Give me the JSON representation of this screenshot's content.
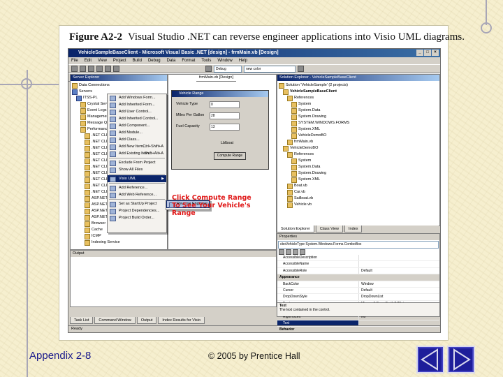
{
  "slide": {
    "figure_label": "Figure A2-2",
    "figure_caption": "Visual Studio .NET can reverse engineer applications into Visio UML diagrams.",
    "footer_left": "Appendix 2-8",
    "footer_center": "© 2005 by Prentice Hall"
  },
  "vs": {
    "title": "VehicleSampleBaseClient - Microsoft Visual Basic .NET [design] - frmMain.vb [Design]",
    "menu": [
      "File",
      "Edit",
      "View",
      "Project",
      "Build",
      "Debug",
      "Data",
      "Format",
      "Tools",
      "Window",
      "Help"
    ],
    "config_combo": "Debug",
    "find_combo": "new color",
    "server_explorer": {
      "title": "Server Explorer",
      "items": [
        "Data Connections",
        "Servers",
        "ITSS-PL",
        "Crystal Services",
        "Event Logs",
        "Management Data",
        "Message Queues",
        "Performance Counters",
        ".NET CLR Data",
        ".NET CLR Exceptions",
        ".NET CLR Interop",
        ".NET CLR Jit",
        ".NET CLR Loading",
        ".NET CLR LocksAndThreads",
        ".NET CLR Memory",
        ".NET CLR Networking",
        ".NET CLR Remoting",
        ".NET CLR Security",
        "ASP.NET",
        "ASP.NET Applications",
        "ASP.NET Apps v1.1.4322",
        "ASP.NET v1.1.4322",
        "Browser",
        "Cache",
        "ICMP",
        "Indexing Service"
      ]
    },
    "project_menu": {
      "items": [
        {
          "label": "Add Windows Form...",
          "key": ""
        },
        {
          "label": "Add Inherited Form...",
          "key": ""
        },
        {
          "label": "Add User Control...",
          "key": ""
        },
        {
          "label": "Add Inherited Control...",
          "key": ""
        },
        {
          "label": "Add Component...",
          "key": ""
        },
        {
          "label": "Add Module...",
          "key": ""
        },
        {
          "label": "Add Class...",
          "key": ""
        },
        {
          "label": "Add New Item...",
          "key": "Ctrl+Shift+A"
        },
        {
          "label": "Add Existing Item...",
          "key": "Shift+Alt+A"
        },
        {
          "label": "Exclude From Project",
          "key": ""
        },
        {
          "label": "Show All Files",
          "key": ""
        },
        {
          "label": "Visio UML",
          "key": ""
        },
        {
          "label": "Add Reference...",
          "key": ""
        },
        {
          "label": "Add Web Reference...",
          "key": ""
        },
        {
          "label": "Set as StartUp Project",
          "key": ""
        },
        {
          "label": "Project Dependencies...",
          "key": ""
        },
        {
          "label": "Project Build Order...",
          "key": ""
        }
      ],
      "submenu_item": "Reverse Engineer"
    },
    "editor": {
      "tab_label": "frmMain.vb [Design]",
      "form_title": "Vehicle Range",
      "fields": [
        {
          "label": "Vehicle Type",
          "value": "0"
        },
        {
          "label": "Miles Per Gallon",
          "value": "28"
        },
        {
          "label": "Fuel Capacity",
          "value": "13"
        }
      ],
      "checkbox_label": "Lblboat",
      "compute_button": "Compute Range",
      "annotation": "Click Compute Range To See Your Vehicle's Range"
    },
    "output_title": "Output",
    "solution_explorer": {
      "title": "Solution Explorer - VehicleSampleBaseClient",
      "items": [
        "Solution 'VehicleSample' (2 projects)",
        "VehicleSampleBaseClient",
        "References",
        "System",
        "System.Data",
        "System.Drawing",
        "SYSTEM.WINDOWS.FORMS",
        "System.XML",
        "VehicleDemoBO",
        "frmMain.vb",
        "VehicleDemoBO",
        "References",
        "System",
        "System.Data",
        "System.Drawing",
        "System.XML",
        "Boat.vb",
        "Car.vb",
        "Sailboat.vb",
        "Vehicle.vb"
      ]
    },
    "right_tabs": [
      "Solution Explorer",
      "Class View",
      "Index"
    ],
    "properties": {
      "title": "Properties",
      "selected_object": "cboVehicleType  System.Windows.Forms.ComboBox",
      "rows": [
        {
          "name": "AccessibleDescription",
          "value": "",
          "type": "row"
        },
        {
          "name": "AccessibleName",
          "value": "",
          "type": "row"
        },
        {
          "name": "AccessibleRole",
          "value": "Default",
          "type": "row"
        },
        {
          "name": "Appearance",
          "value": "",
          "type": "cat"
        },
        {
          "name": "BackColor",
          "value": "Window",
          "type": "row"
        },
        {
          "name": "Cursor",
          "value": "Default",
          "type": "row"
        },
        {
          "name": "DropDownStyle",
          "value": "DropDownList",
          "type": "row"
        },
        {
          "name": "Font",
          "value": "Microsoft Sans Serif, 8.25pt",
          "type": "row"
        },
        {
          "name": "ForeColor",
          "value": "WindowText",
          "type": "row"
        },
        {
          "name": "RightToLeft",
          "value": "No",
          "type": "row"
        },
        {
          "name": "Text",
          "value": "",
          "type": "sel"
        },
        {
          "name": "Behavior",
          "value": "",
          "type": "cat"
        }
      ],
      "desc_title": "Text",
      "desc_body": "The text contained in the control."
    },
    "bottom_tabs": [
      "Task List",
      "Command Window",
      "Output",
      "Index Results for Visio"
    ],
    "status": "Ready"
  },
  "colors": {
    "background": "#f6efcf",
    "footer_left": "#1a1a8c",
    "annotation": "#e01818",
    "nav_button": "#1e1e9a"
  },
  "icons": [
    "close-icon",
    "folder-icon",
    "server-icon",
    "play-triangle-icon"
  ]
}
